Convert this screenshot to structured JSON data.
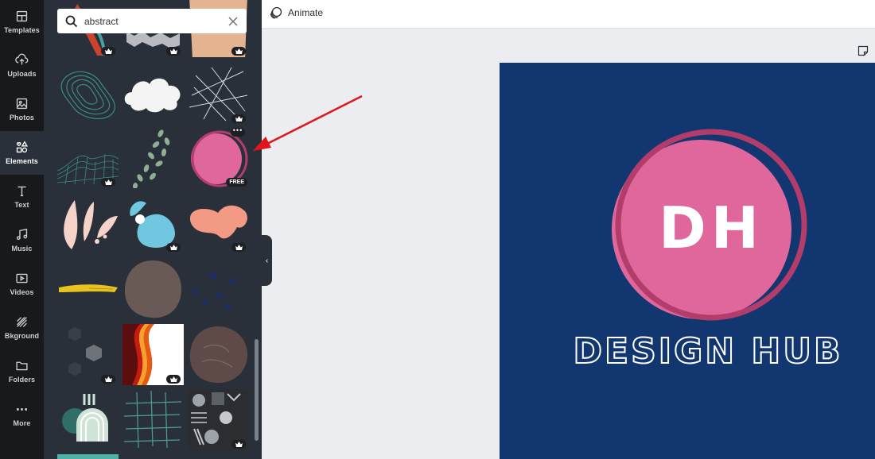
{
  "sidebar": {
    "items": [
      {
        "label": "Templates",
        "icon": "templates-icon"
      },
      {
        "label": "Uploads",
        "icon": "upload-icon"
      },
      {
        "label": "Photos",
        "icon": "photo-icon"
      },
      {
        "label": "Elements",
        "icon": "elements-icon",
        "active": true
      },
      {
        "label": "Text",
        "icon": "text-icon"
      },
      {
        "label": "Music",
        "icon": "music-icon"
      },
      {
        "label": "Videos",
        "icon": "video-icon"
      },
      {
        "label": "Bkground",
        "icon": "background-icon"
      },
      {
        "label": "Folders",
        "icon": "folder-icon"
      },
      {
        "label": "More",
        "icon": "more-dots-icon"
      }
    ]
  },
  "search": {
    "value": "abstract"
  },
  "elements_panel": {
    "free_badge": "FREE",
    "more_badge": "•••"
  },
  "toolbar": {
    "animate_label": "Animate"
  },
  "canvas": {
    "monogram": "DH",
    "brand_name": "DESIGN HUB",
    "background_color": "#123670",
    "circle_color": "#e0679c",
    "ring_color": "#b23d6a"
  },
  "colors": {
    "panel_bg": "#293039",
    "rail_bg": "#18191b",
    "annotation_arrow": "#e0161b"
  }
}
